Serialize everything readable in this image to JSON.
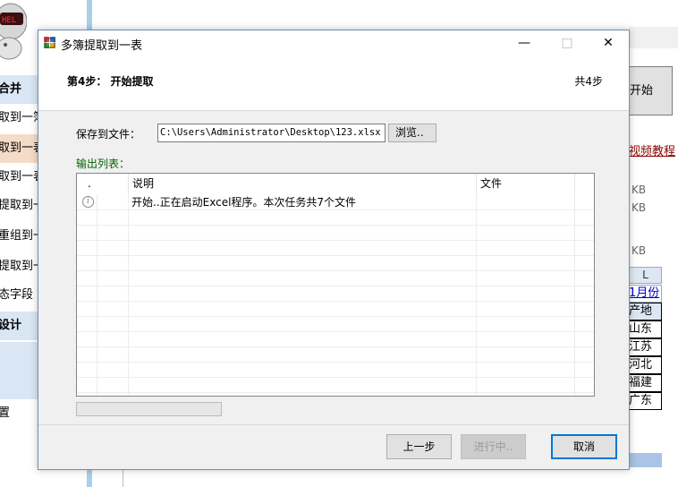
{
  "background": {
    "sidebar_items": [
      {
        "label": "合并",
        "kind": "group"
      },
      {
        "label": "取到一簿",
        "kind": "item"
      },
      {
        "label": "取到一表",
        "kind": "active"
      },
      {
        "label": "取到一表",
        "kind": "item"
      },
      {
        "label": "提取到一",
        "kind": "item"
      },
      {
        "label": "重组到一",
        "kind": "item"
      },
      {
        "label": "提取到一",
        "kind": "item"
      },
      {
        "label": "态字段",
        "kind": "item"
      },
      {
        "label": "设计",
        "kind": "group"
      },
      {
        "label": "",
        "kind": "blank"
      },
      {
        "label": "",
        "kind": "blank"
      },
      {
        "label": "置",
        "kind": "item"
      }
    ],
    "start_button_label": "开始",
    "video_link_label": "视频教程",
    "size_labels": [
      "KB",
      "KB",
      "KB"
    ],
    "grid": {
      "column_header": "L",
      "cells": [
        "1月份",
        "产地",
        "山东",
        "江苏",
        "河北",
        "福建",
        "广东"
      ]
    }
  },
  "dialog": {
    "title": "多簿提取到一表",
    "step_title": "第4步： 开始提取",
    "step_count": "共4步",
    "save_label": "保存到文件：",
    "save_path": "C:\\Users\\Administrator\\Desktop\\123.xlsx",
    "browse_label": "浏览..",
    "output_label": "输出列表：",
    "columns": [
      ".",
      "",
      "说明",
      "文件"
    ],
    "rows": [
      {
        "icon": "info-icon",
        "description": "开始..正在启动Excel程序。本次任务共7个文件",
        "file": ""
      }
    ],
    "progress": 0,
    "buttons": {
      "prev": "上一步",
      "running": "进行中..",
      "cancel": "取消"
    }
  }
}
